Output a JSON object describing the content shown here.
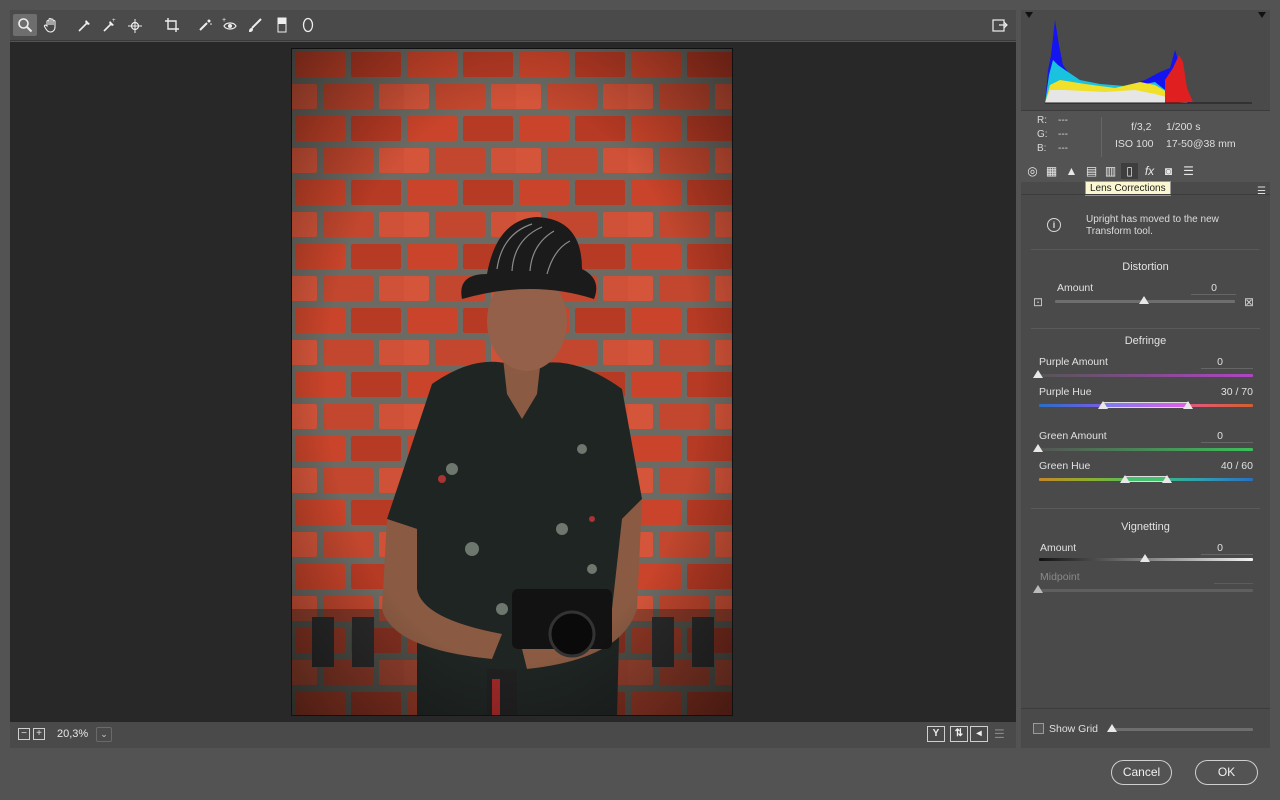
{
  "toolbar": {
    "tools": [
      "zoom-icon",
      "hand-icon",
      "white-balance-icon",
      "color-sampler-icon",
      "targeted-adjustment-icon",
      "crop-icon",
      "spot-removal-icon",
      "red-eye-icon",
      "adjustment-brush-icon",
      "graduated-filter-icon",
      "radial-filter-icon"
    ],
    "export_icon": "open-in-preferences-icon"
  },
  "zoom": {
    "value": "20,3%"
  },
  "readout": {
    "r_label": "R:",
    "r_value": "---",
    "g_label": "G:",
    "g_value": "---",
    "b_label": "B:",
    "b_value": "---",
    "aperture": "f/3,2",
    "shutter": "1/200 s",
    "iso": "ISO 100",
    "lens": "17-50@38 mm"
  },
  "tabs": {
    "tooltip": "Lens Corrections",
    "active": "lens-corrections"
  },
  "info": {
    "text": "Upright has moved to the new Transform tool."
  },
  "distortion": {
    "title": "Distortion",
    "amount_label": "Amount",
    "amount_value": "0",
    "amount_pos": 0.5
  },
  "defringe": {
    "title": "Defringe",
    "purple_amount_label": "Purple Amount",
    "purple_amount_value": "0",
    "purple_hue_label": "Purple Hue",
    "purple_hue_value": "30 / 70",
    "green_amount_label": "Green Amount",
    "green_amount_value": "0",
    "green_hue_label": "Green Hue",
    "green_hue_value": "40 / 60"
  },
  "vignetting": {
    "title": "Vignetting",
    "amount_label": "Amount",
    "amount_value": "0",
    "midpoint_label": "Midpoint"
  },
  "grid": {
    "label": "Show Grid"
  },
  "buttons": {
    "cancel": "Cancel",
    "ok": "OK"
  },
  "colors": {
    "panel": "#4a4a4a",
    "canvas": "#282828",
    "tooltip": "#fbf7d0"
  }
}
